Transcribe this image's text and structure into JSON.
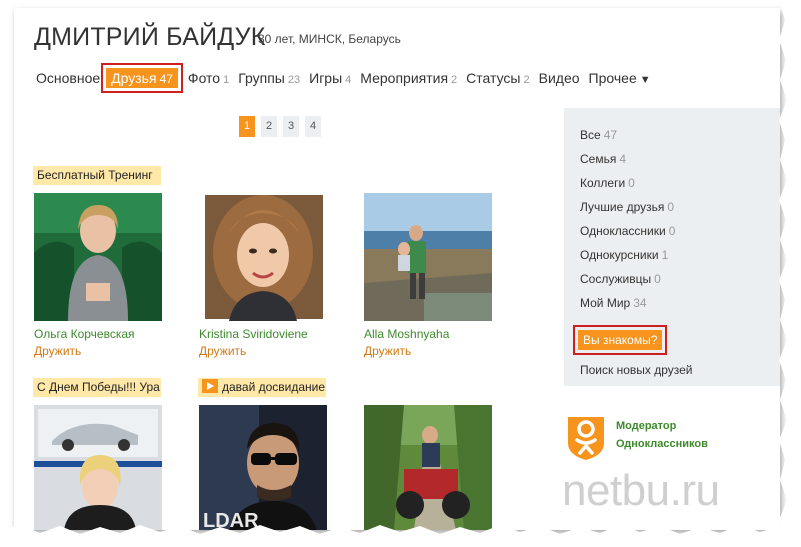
{
  "profile": {
    "name": "ДМИТРИЙ БАЙДУК",
    "meta": "30 лет, МИНСК, Беларусь"
  },
  "nav": [
    {
      "label": "Основное",
      "count": ""
    },
    {
      "label": "Друзья",
      "count": "47"
    },
    {
      "label": "Фото",
      "count": "1"
    },
    {
      "label": "Группы",
      "count": "23"
    },
    {
      "label": "Игры",
      "count": "4"
    },
    {
      "label": "Мероприятия",
      "count": "2"
    },
    {
      "label": "Статусы",
      "count": "2"
    },
    {
      "label": "Видео",
      "count": ""
    },
    {
      "label": "Прочее",
      "count": "▼"
    }
  ],
  "pager": [
    "1",
    "2",
    "3",
    "4"
  ],
  "friends": [
    {
      "banner": "Бесплатный Тренинг",
      "name": "Ольга Корчевская",
      "action": "Дружить"
    },
    {
      "banner": "",
      "name": "Kristina Sviridoviene",
      "action": "Дружить"
    },
    {
      "banner": "",
      "name": "Alla Moshnyaha",
      "action": "Дружить"
    },
    {
      "banner": "С Днем Победы!!! Ура",
      "name": "",
      "action": ""
    },
    {
      "banner": "давай досвидание",
      "name": "",
      "action": ""
    },
    {
      "banner": "",
      "name": "",
      "action": ""
    }
  ],
  "photo_overlay_text": "LDAR",
  "sidebar": {
    "items": [
      {
        "label": "Все",
        "count": "47"
      },
      {
        "label": "Семья",
        "count": "4"
      },
      {
        "label": "Коллеги",
        "count": "0"
      },
      {
        "label": "Лучшие друзья",
        "count": "0"
      },
      {
        "label": "Одноклассники",
        "count": "0"
      },
      {
        "label": "Однокурсники",
        "count": "1"
      },
      {
        "label": "Сослуживцы",
        "count": "0"
      },
      {
        "label": "Мой Мир",
        "count": "34"
      }
    ],
    "know_label": "Вы знакомы?",
    "search_label": "Поиск новых друзей"
  },
  "moderator": {
    "line1": "Модератор",
    "line2": "Одноклассников",
    "icon": "odnoklassniki-icon"
  },
  "watermark": "netbu.ru",
  "colors": {
    "accent": "#f7941d",
    "highlight_border": "#d01f1f",
    "link_green": "#3d8a2c",
    "link_orange": "#d07a14",
    "panel_bg": "#eceff2",
    "banner_bg": "#ffe8a8"
  }
}
